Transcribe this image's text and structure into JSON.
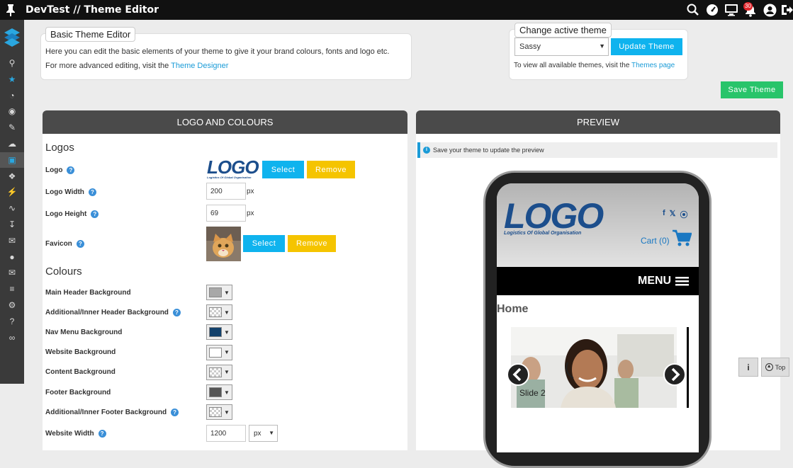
{
  "app": {
    "title": "DevTest // Theme Editor",
    "notification_count": "30"
  },
  "topbar_icons": [
    "search-icon",
    "dashboard-icon",
    "monitor-icon",
    "bell-icon",
    "user-icon",
    "logout-icon"
  ],
  "sidebar": {
    "items": [
      "search-icon",
      "star-icon",
      "dashboard-icon",
      "globe-icon",
      "pencil-icon",
      "cloud-icon",
      "monitor-icon",
      "puzzle-icon",
      "plug-icon",
      "chart-icon",
      "download-icon",
      "chat-icon",
      "user-icon",
      "mail-icon",
      "sliders-icon",
      "gear-icon",
      "help-icon",
      "link-icon"
    ],
    "active_index": 6
  },
  "basic_editor": {
    "legend": "Basic Theme Editor",
    "line1": "Here you can edit the basic elements of your theme to give it your brand colours, fonts and logo etc.",
    "line2_prefix": "For more advanced editing, visit the ",
    "line2_link": "Theme Designer"
  },
  "change_theme": {
    "legend": "Change active theme",
    "selected": "Sassy",
    "update_label": "Update Theme",
    "note_prefix": "To view all available themes, visit the ",
    "note_link": "Themes page"
  },
  "save_label": "Save Theme",
  "left_panel": {
    "header": "LOGO AND COLOURS",
    "logos_title": "Logos",
    "logo_label": "Logo",
    "logo_text": "LOGO",
    "logo_tagline": "Logistics Of Global Organisation",
    "select_label": "Select",
    "remove_label": "Remove",
    "logo_width_label": "Logo Width",
    "logo_width": "200",
    "logo_height_label": "Logo Height",
    "logo_height": "69",
    "unit_px": "px",
    "favicon_label": "Favicon",
    "colours_title": "Colours",
    "colours": [
      {
        "label": "Main Header Background",
        "color": "#a8a8a8",
        "help": false
      },
      {
        "label": "Additional/Inner Header Background",
        "color": "checker",
        "help": true
      },
      {
        "label": "Nav Menu Background",
        "color": "#12416c",
        "help": false
      },
      {
        "label": "Website Background",
        "color": "#ffffff",
        "help": false
      },
      {
        "label": "Content Background",
        "color": "checker",
        "help": false
      },
      {
        "label": "Footer Background",
        "color": "#555555",
        "help": false
      },
      {
        "label": "Additional/Inner Footer Background",
        "color": "checker",
        "help": true
      }
    ],
    "website_width_label": "Website Width",
    "website_width": "1200",
    "website_width_unit": "px"
  },
  "preview": {
    "header": "PREVIEW",
    "notice": "Save your theme to update the preview",
    "logo_text": "LOGO",
    "logo_tagline": "Logistics Of Global Organisation",
    "cart": "Cart (0)",
    "menu": "MENU",
    "home": "Home",
    "slide": "Slide 2"
  },
  "floating": {
    "info": "i",
    "top": "Top"
  }
}
